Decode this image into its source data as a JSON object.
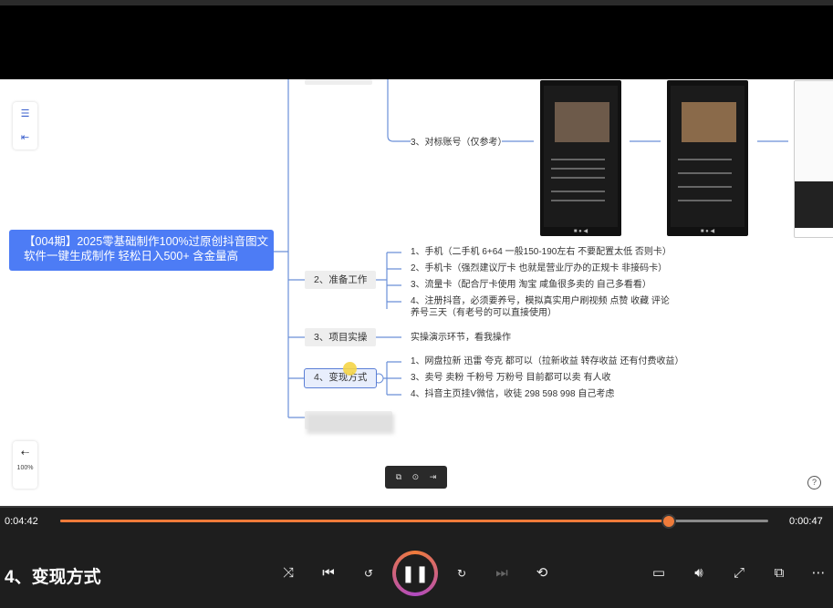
{
  "mindmap": {
    "root_line1": "【004期】2025零基础制作100%过原创抖音图文",
    "root_line2": "软件一键生成制作 轻松日入500+ 含金量高",
    "top_leaf": "3、对标账号（仅参考）",
    "branches": {
      "prep": "2、准备工作",
      "practice": "3、项目实操",
      "monetize": "4、变现方式"
    },
    "prep_items": [
      "1、手机（二手机 6+64 一般150-190左右 不要配置太低 否则卡）",
      "2、手机卡（强烈建议厅卡 也就是营业厅办的正规卡 非接码卡）",
      "3、流量卡（配合厅卡使用 淘宝 咸鱼很多卖的 自己多看看）",
      "4、注册抖音，必须要养号，模拟真实用户刷视频 点赞 收藏 评论 养号三天（有老号的可以直接使用）"
    ],
    "practice_item": "实操演示环节，看我操作",
    "monetize_items": [
      "1、网盘拉新 迅雷 夸克 都可以（拉新收益 转存收益 还有付费收益）",
      "3、卖号 卖粉 千粉号 万粉号 目前都可以卖 有人收",
      "4、抖音主页挂V微信，收徒 298 598 998 自己考虑"
    ]
  },
  "zoom": "100%",
  "player": {
    "elapsed": "0:04:42",
    "remaining": "0:00:47",
    "progress": 0.857,
    "chapter_title": "4、变现方式",
    "accent": "#ef7b3a"
  },
  "icons": [
    "list-icon",
    "outline-icon",
    "collapse-icon",
    "copy-icon",
    "settings-icon",
    "exit-icon",
    "help-icon",
    "shuffle-icon",
    "previous-icon",
    "rewind-10-icon",
    "pause-icon",
    "forward-30-icon",
    "next-icon",
    "repeat-off-icon",
    "subtitles-icon",
    "volume-icon",
    "fullscreen-icon",
    "miniplayer-icon",
    "more-icon"
  ]
}
